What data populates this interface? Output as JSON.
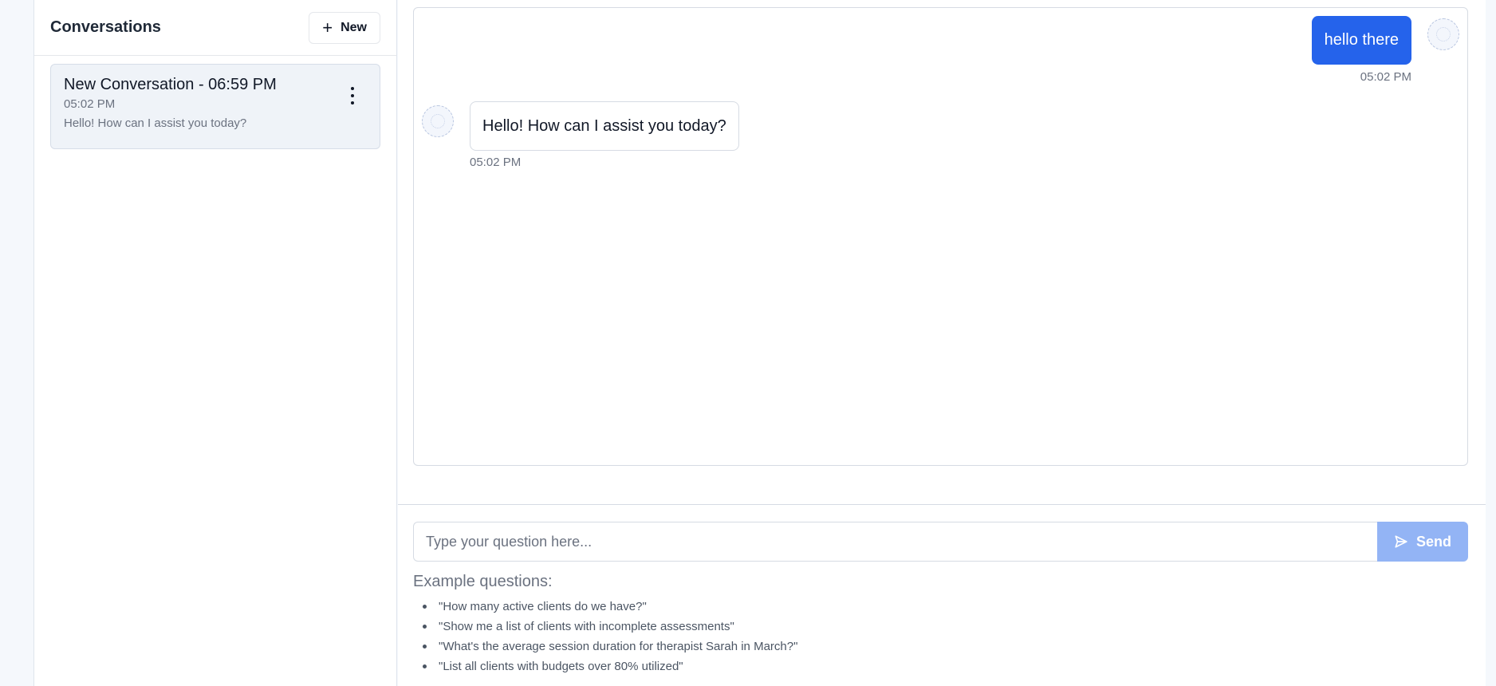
{
  "sidebar": {
    "title": "Conversations",
    "new_button_label": "New",
    "conversations": [
      {
        "title": "New Conversation - 06:59 PM",
        "time": "05:02 PM",
        "preview": "Hello! How can I assist you today?"
      }
    ]
  },
  "chat": {
    "messages": [
      {
        "role": "user",
        "text": "hello there",
        "time": "05:02 PM"
      },
      {
        "role": "assistant",
        "text": "Hello! How can I assist you today?",
        "time": "05:02 PM"
      }
    ]
  },
  "composer": {
    "placeholder": "Type your question here...",
    "value": "",
    "send_label": "Send"
  },
  "examples": {
    "title": "Example questions:",
    "items": [
      "\"How many active clients do we have?\"",
      "\"Show me a list of clients with incomplete assessments\"",
      "\"What's the average session duration for therapist Sarah in March?\"",
      "\"List all clients with budgets over 80% utilized\""
    ]
  },
  "colors": {
    "accent": "#2563eb",
    "send_disabled": "#93b4f5",
    "selected_conversation_bg": "#eff3f8"
  }
}
